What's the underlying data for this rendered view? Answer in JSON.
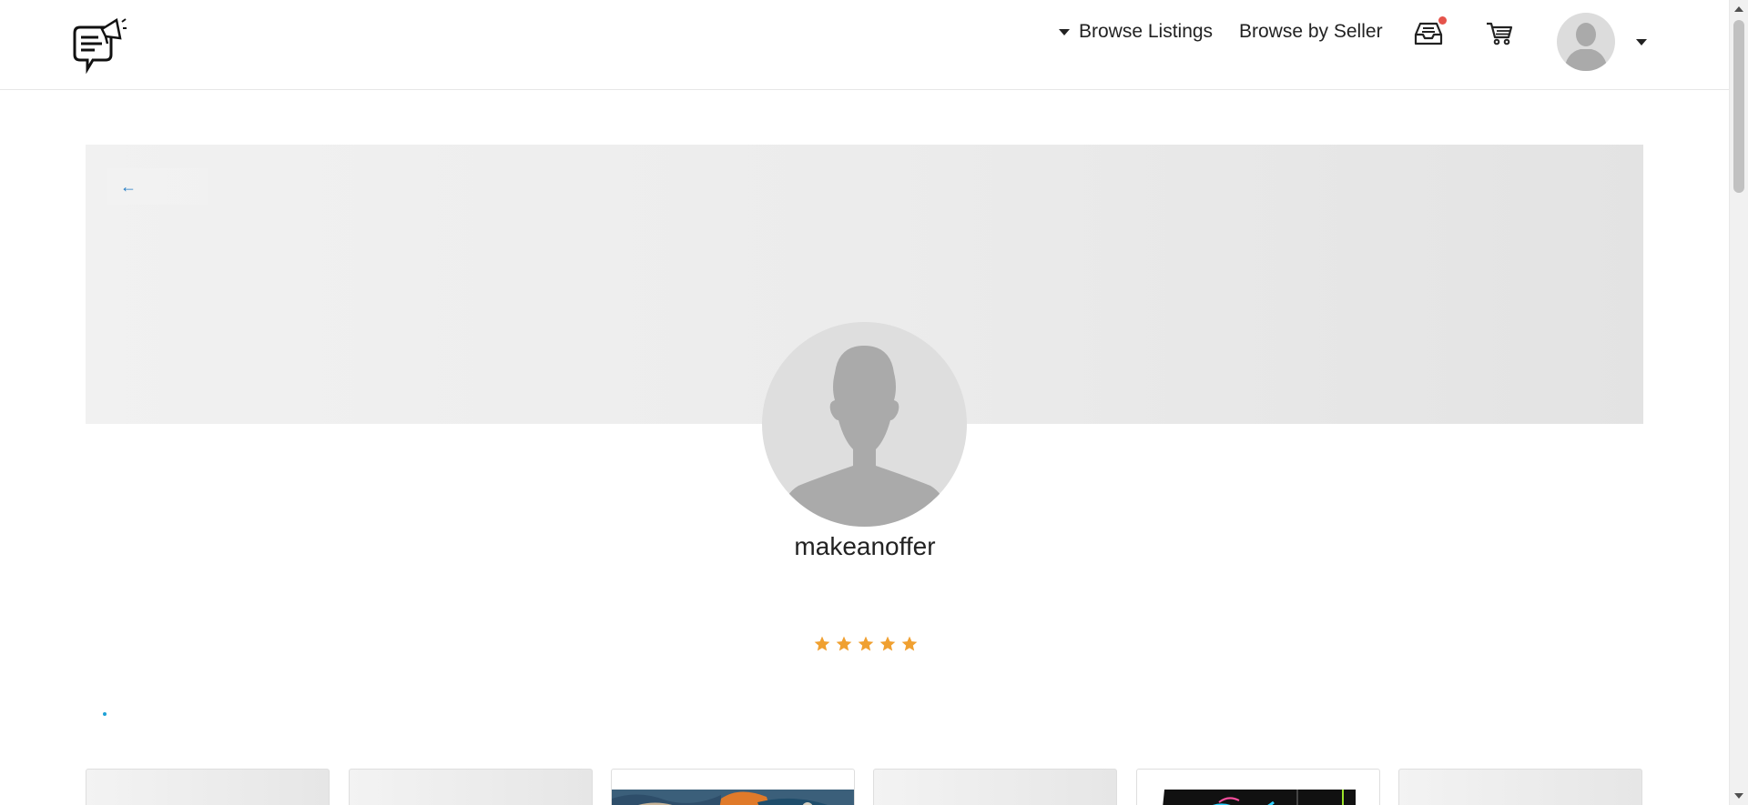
{
  "header": {
    "nav_browse_listings": "Browse Listings",
    "nav_browse_by_seller": "Browse by Seller",
    "notification_color": "#e5534b"
  },
  "banner": {
    "back_arrow": "←"
  },
  "profile": {
    "username": "makeanoffer",
    "rating_stars": 5,
    "star_color": "#f0a030"
  },
  "listings": [
    {
      "kind": "placeholder"
    },
    {
      "kind": "placeholder"
    },
    {
      "kind": "image",
      "icon": "painting-thumbnail"
    },
    {
      "kind": "placeholder"
    },
    {
      "kind": "image",
      "icon": "pc-case-thumbnail"
    },
    {
      "kind": "placeholder"
    }
  ],
  "colors": {
    "accent": "#1f7ac4",
    "loader": "#1ea1d6"
  }
}
